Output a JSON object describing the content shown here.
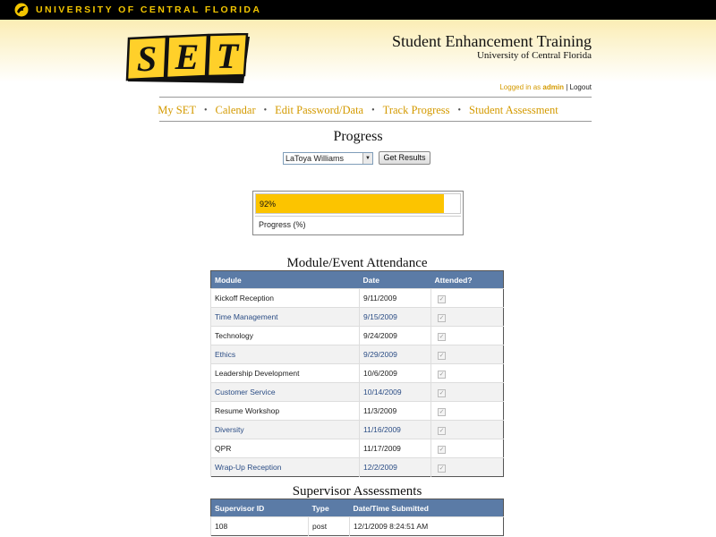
{
  "top_bar": {
    "university_name": "UNIVERSITY OF CENTRAL FLORIDA",
    "colors": {
      "background": "#000000",
      "text": "#f2c500"
    }
  },
  "header": {
    "logo_text": "SET",
    "title": "Student Enhancement Training",
    "subtitle": "University of Central Florida",
    "login": {
      "prefix": "Logged in as",
      "username": "admin",
      "separator": "|",
      "logout_label": "Logout"
    }
  },
  "nav": {
    "items": [
      {
        "label": "My SET"
      },
      {
        "label": "Calendar"
      },
      {
        "label": "Edit Password/Data"
      },
      {
        "label": "Track Progress"
      },
      {
        "label": "Student Assessment"
      }
    ],
    "separator": "•"
  },
  "progress_page": {
    "title": "Progress",
    "student_select": {
      "selected": "LaToya Williams"
    },
    "get_results_label": "Get Results",
    "progress": {
      "value_text": "92%",
      "value_fraction": 0.92,
      "label": "Progress (%)"
    }
  },
  "attendance": {
    "title": "Module/Event Attendance",
    "columns": [
      "Module",
      "Date",
      "Attended?"
    ],
    "rows": [
      {
        "module": "Kickoff Reception",
        "date": "9/11/2009",
        "attended": true,
        "link": false
      },
      {
        "module": "Time Management",
        "date": "9/15/2009",
        "attended": true,
        "link": true
      },
      {
        "module": "Technology",
        "date": "9/24/2009",
        "attended": true,
        "link": false
      },
      {
        "module": "Ethics",
        "date": "9/29/2009",
        "attended": true,
        "link": true
      },
      {
        "module": "Leadership Development",
        "date": "10/6/2009",
        "attended": true,
        "link": false
      },
      {
        "module": "Customer Service",
        "date": "10/14/2009",
        "attended": true,
        "link": true
      },
      {
        "module": "Resume Workshop",
        "date": "11/3/2009",
        "attended": true,
        "link": false
      },
      {
        "module": "Diversity",
        "date": "11/16/2009",
        "attended": true,
        "link": true
      },
      {
        "module": "QPR",
        "date": "11/17/2009",
        "attended": true,
        "link": false
      },
      {
        "module": "Wrap-Up Reception",
        "date": "12/2/2009",
        "attended": true,
        "link": true
      }
    ]
  },
  "supervisor": {
    "title": "Supervisor Assessments",
    "columns": [
      "Supervisor ID",
      "Type",
      "Date/Time Submitted"
    ],
    "rows": [
      {
        "id": "108",
        "type": "post",
        "submitted": "12/1/2009 8:24:51 AM"
      }
    ]
  },
  "colors": {
    "accent_gold": "#d49a00",
    "progress_fill": "#fcc400",
    "table_header": "#5b7ba6",
    "link_blue": "#2b4d85"
  }
}
